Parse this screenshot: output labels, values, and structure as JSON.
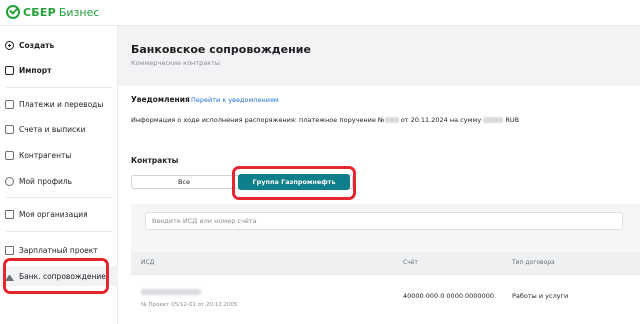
{
  "brand": {
    "name": "СБЕР",
    "product": "Бизнес"
  },
  "sidebar": {
    "items": [
      {
        "label": "Создать"
      },
      {
        "label": "Импорт"
      },
      {
        "label": "Платежи и переводы"
      },
      {
        "label": "Счета и выписки"
      },
      {
        "label": "Контрагенты"
      },
      {
        "label": "Мой профиль"
      },
      {
        "label": "Моя организация"
      },
      {
        "label": "Зарплатный проект"
      },
      {
        "label": "Банк. сопровождение"
      }
    ]
  },
  "page": {
    "title": "Банковское сопровождение",
    "subtitle": "Коммерческие контракты"
  },
  "notifications": {
    "title": "Уведомления",
    "link": "Перейти к уведомлениям",
    "text_prefix": "Информация о ходе исполнения распоряжения: платежное поручение №",
    "text_middle": " от 20.11.2024 на сумму ",
    "text_suffix": " RUB"
  },
  "contracts": {
    "title": "Контракты",
    "segments": {
      "all": "Все",
      "group": "Группа Газпромнефть"
    },
    "search_placeholder": "Введите ИСД или номер счёта",
    "columns": {
      "isd": "ИСД",
      "account": "Счёт",
      "type": "Тип договора"
    },
    "rows": [
      {
        "sub": "№ Проект 05/12-01 от 20.12.2005",
        "account": "40000 000 0 0000 0000000",
        "type": "Работы и услуги"
      }
    ]
  },
  "colors": {
    "brand": "#21a038",
    "accent": "#107f8c",
    "link": "#1e6fd9",
    "highlight": "#e3262f"
  }
}
